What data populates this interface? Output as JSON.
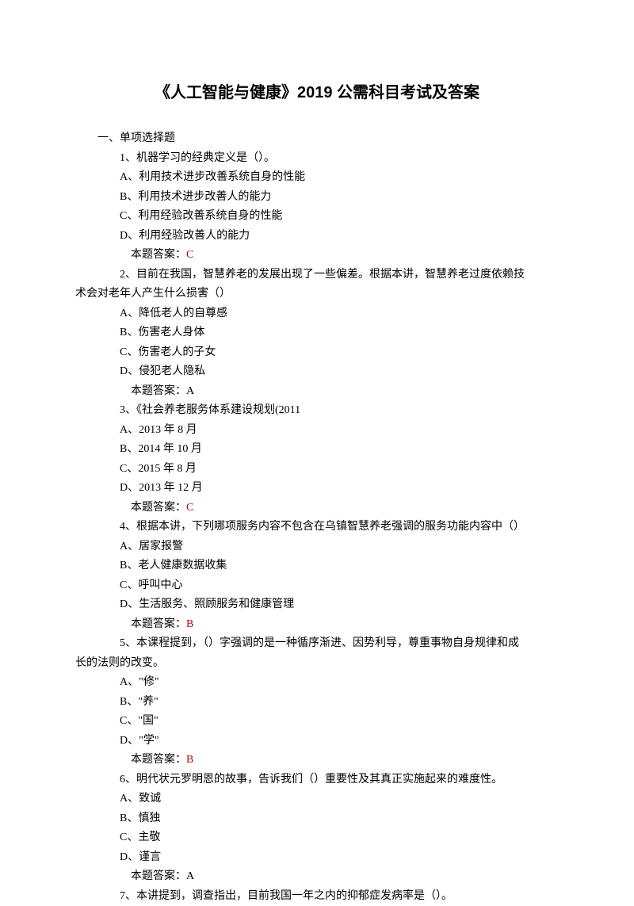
{
  "title": "《人工智能与健康》2019 公需科目考试及答案",
  "sectionHeader": "一、单项选择题",
  "answerLabel": "本题答案：",
  "questions": [
    {
      "stem": "1、机器学习的经典定义是（）。",
      "options": [
        "A、利用技术进步改善系统自身的性能",
        "B、利用技术进步改善人的能力",
        "C、利用经验改善系统自身的性能",
        "D、利用经验改善人的能力"
      ],
      "answer": "C",
      "answerColor": "red"
    },
    {
      "stem": "2、目前在我国，智慧养老的发展出现了一些偏差。根据本讲，智慧养老过度依赖技",
      "stemCont": "术会对老年人产生什么损害（）",
      "options": [
        "A、降低老人的自尊感",
        "B、伤害老人身体",
        "C、伤害老人的子女",
        "D、侵犯老人隐私"
      ],
      "answer": "A",
      "answerColor": "black"
    },
    {
      "stem": "3、《社会养老服务体系建设规划(2011",
      "options": [
        "A、2013 年 8 月",
        "B、2014 年 10 月",
        "C、2015 年 8 月",
        "D、2013 年 12 月"
      ],
      "answer": "C",
      "answerColor": "red"
    },
    {
      "stem": "4、根据本讲，下列哪项服务内容不包含在乌镇智慧养老强调的服务功能内容中（）",
      "options": [
        "A、居家报警",
        "B、老人健康数据收集",
        "C、呼叫中心",
        "D、生活服务、照顾服务和健康管理"
      ],
      "answer": "B",
      "answerColor": "red"
    },
    {
      "stem": "5、本课程提到，（）字强调的是一种循序渐进、因势利导，尊重事物自身规律和成",
      "stemCont": "长的法则的改变。",
      "options": [
        "A、\"修\"",
        "B、\"养\"",
        "C、\"国\"",
        "D、\"学\""
      ],
      "answer": "B",
      "answerColor": "red"
    },
    {
      "stem": "6、明代状元罗明恩的故事，告诉我们（）重要性及其真正实施起来的难度性。",
      "options": [
        "A、致诚",
        "B、慎独",
        "C、主敬",
        "D、谨言"
      ],
      "answer": "A",
      "answerColor": "black"
    },
    {
      "stem": "7、本讲提到，调查指出，目前我国一年之内的抑郁症发病率是（）。",
      "options": [],
      "answer": null
    }
  ]
}
